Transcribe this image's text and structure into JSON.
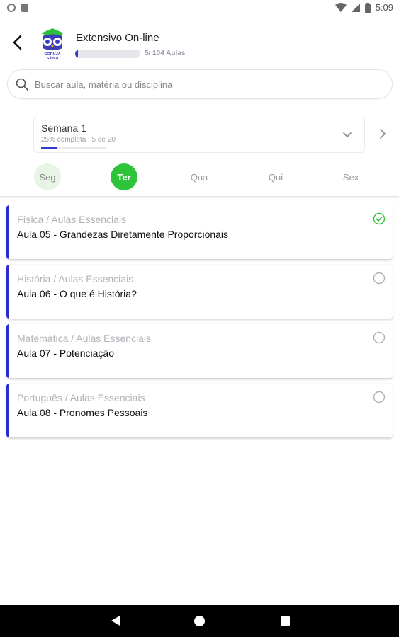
{
  "status_bar": {
    "time": "5:09"
  },
  "header": {
    "title": "Extensivo On-line",
    "progress_label": "5/ 104 Aulas",
    "progress_fraction": 0.048,
    "logo_text_line1": "CORUJA",
    "logo_text_line2": "SÁBIA"
  },
  "search": {
    "placeholder": "Buscar aula, matéria ou disciplina"
  },
  "week": {
    "title": "Semana 1",
    "subtitle": "25% completa | 5 de 20",
    "progress_fraction": 0.25
  },
  "days": [
    {
      "label": "Seg",
      "state": "done"
    },
    {
      "label": "Ter",
      "state": "active"
    },
    {
      "label": "Qua",
      "state": "default"
    },
    {
      "label": "Qui",
      "state": "default"
    },
    {
      "label": "Sex",
      "state": "default"
    }
  ],
  "lessons": [
    {
      "category": "Física / Aulas Essenciais",
      "title": "Aula 05 - Grandezas Diretamente Proporcionais",
      "completed": true
    },
    {
      "category": "História / Aulas Essenciais",
      "title": "Aula 06 - O que é História?",
      "completed": false
    },
    {
      "category": "Matemática / Aulas Essenciais",
      "title": "Aula 07 - Potenciação",
      "completed": false
    },
    {
      "category": "Português / Aulas Essenciais",
      "title": "Aula 08 - Pronomes Pessoais",
      "completed": false
    }
  ],
  "colors": {
    "accent_blue": "#2b2bd0",
    "active_green": "#2fc33a",
    "done_green_bg": "#e6f5e4"
  }
}
